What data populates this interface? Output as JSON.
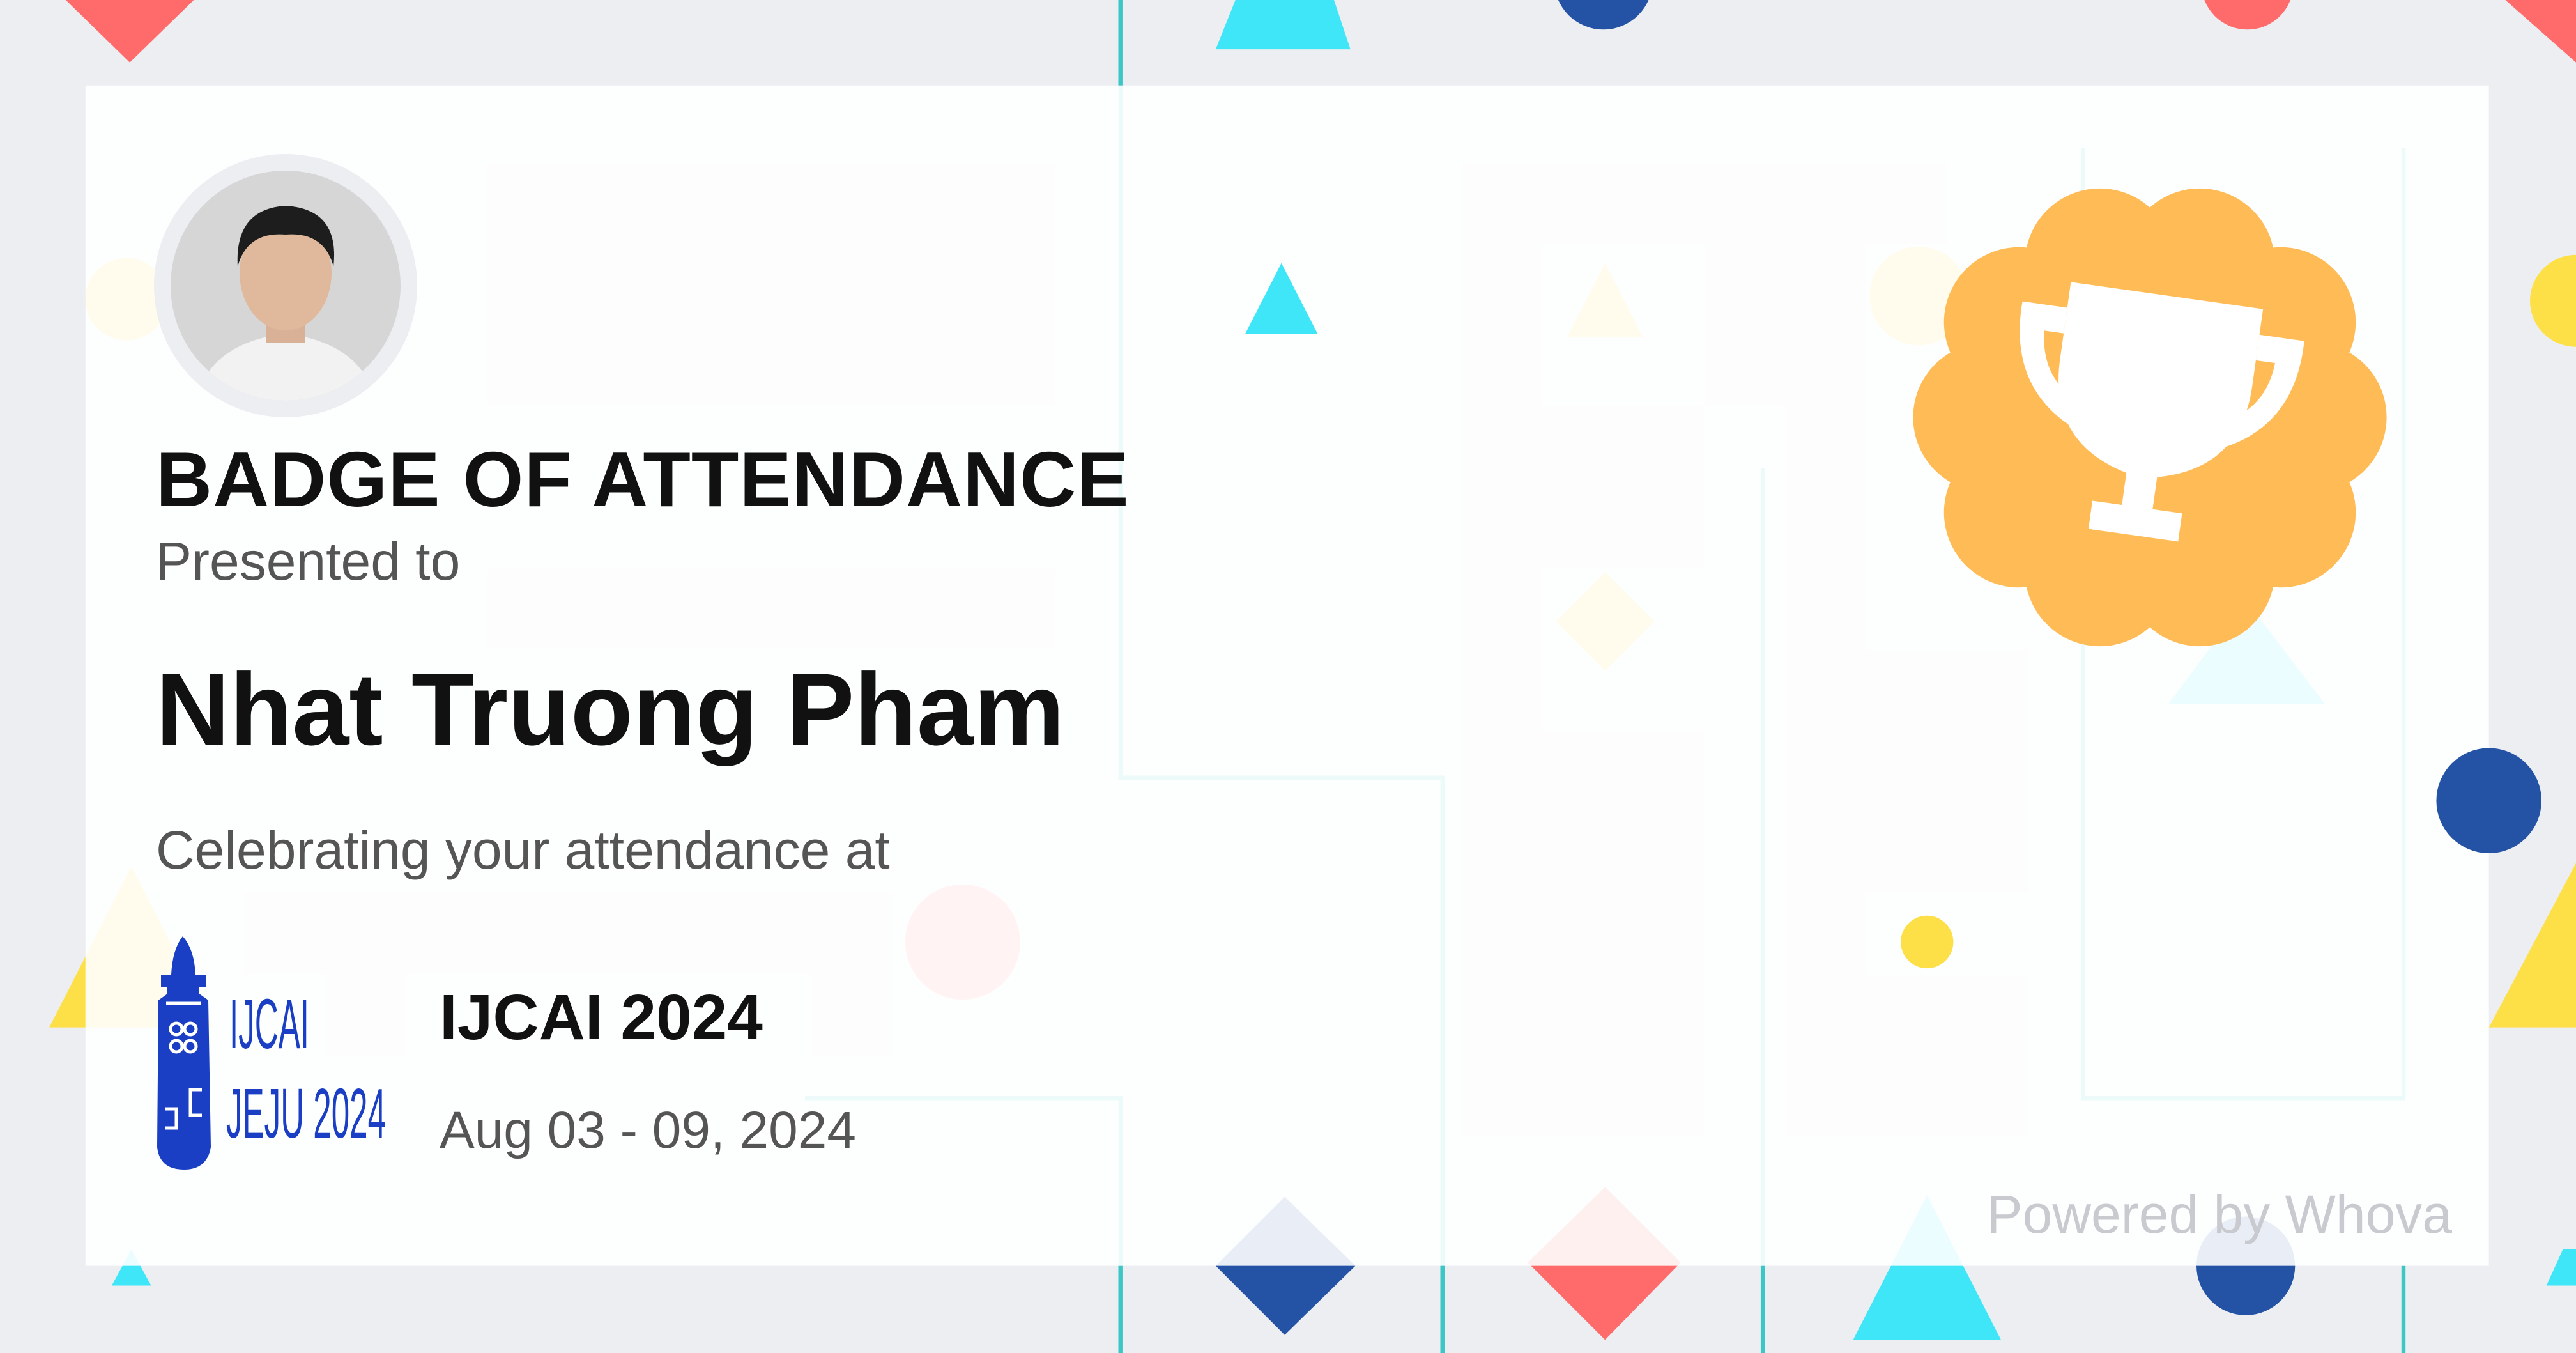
{
  "badge": {
    "title": "BADGE OF ATTENDANCE",
    "presented_label": "Presented to",
    "recipient_name": "Nhat Truong Pham",
    "celebrating_label": "Celebrating your attendance at"
  },
  "event": {
    "name": "IJCAI 2024",
    "dates": "Aug 03 - 09, 2024",
    "logo_text_line1": "IJCAI",
    "logo_text_line2": "JEJU 2024"
  },
  "footer": {
    "powered_by": "Powered by Whova"
  },
  "icons": {
    "award": "trophy-icon",
    "avatar": "user-photo"
  },
  "colors": {
    "background": "#eceef2",
    "card": "#ffffff",
    "badge_orange": "#ffbb55",
    "navy": "#2452a4",
    "cyan": "#3ee6f8",
    "red": "#ff6b6b",
    "yellow": "#fde047",
    "logo_blue": "#1a3fc4"
  }
}
